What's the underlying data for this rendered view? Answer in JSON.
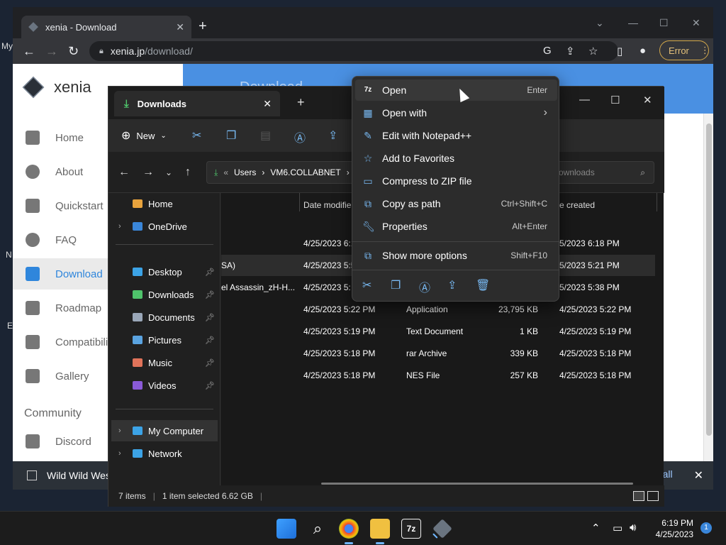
{
  "desktop": {
    "fragments": [
      "My",
      "N",
      "E"
    ]
  },
  "browser": {
    "tab_title": "xenia - Download",
    "url_host": "xenia.jp",
    "url_path": "/download/",
    "error_label": "Error"
  },
  "site": {
    "brand": "xenia",
    "header_title": "Download",
    "nav": [
      {
        "label": "Home"
      },
      {
        "label": "About"
      },
      {
        "label": "Quickstart"
      },
      {
        "label": "FAQ"
      },
      {
        "label": "Download"
      },
      {
        "label": "Roadmap"
      },
      {
        "label": "Compatibilit"
      },
      {
        "label": "Gallery"
      }
    ],
    "community_heading": "Community",
    "community_nav": [
      {
        "label": "Discord"
      }
    ],
    "banner_text": "Wild Wild West",
    "banner_action": "r all"
  },
  "explorer": {
    "tab_title": "Downloads",
    "new_label": "New",
    "breadcrumb": [
      "Users",
      "VM6.COLLABNET"
    ],
    "search_placeholder": "Search Downloads",
    "search_visible": "ownloads",
    "tree": {
      "home": "Home",
      "onedrive": "OneDrive",
      "pinned": [
        "Desktop",
        "Downloads",
        "Documents",
        "Pictures",
        "Music",
        "Videos"
      ],
      "my_computer": "My Computer",
      "network": "Network"
    },
    "columns": {
      "date_modified": "Date modifie",
      "date_created": "e created"
    },
    "rows": [
      {
        "name": "",
        "modified": "4/25/2023 6:1",
        "type": "",
        "size": "",
        "created": "5/2023 6:18 PM"
      },
      {
        "name": "SA)",
        "modified": "4/25/2023 5:5",
        "type": "",
        "size": "",
        "created": "5/2023 5:21 PM"
      },
      {
        "name": "el Assassin_zH-H...",
        "modified": "4/25/2023 5:",
        "type": "",
        "size": "",
        "created": "5/2023 5:38 PM"
      },
      {
        "name": "",
        "modified": "4/25/2023 5:22 PM",
        "type": "Application",
        "size": "23,795 KB",
        "created": "4/25/2023 5:22 PM"
      },
      {
        "name": "",
        "modified": "4/25/2023 5:19 PM",
        "type": "Text Document",
        "size": "1 KB",
        "created": "4/25/2023 5:19 PM"
      },
      {
        "name": "",
        "modified": "4/25/2023 5:18 PM",
        "type": "rar Archive",
        "size": "339 KB",
        "created": "4/25/2023 5:18 PM"
      },
      {
        "name": "",
        "modified": "4/25/2023 5:18 PM",
        "type": "NES File",
        "size": "257 KB",
        "created": "4/25/2023 5:18 PM"
      }
    ],
    "status": {
      "items": "7 items",
      "selected": "1 item selected  6.62 GB"
    }
  },
  "context_menu": {
    "items": [
      {
        "label": "Open",
        "shortcut": "Enter"
      },
      {
        "label": "Open with",
        "shortcut": ""
      },
      {
        "label": "Edit with Notepad++",
        "shortcut": ""
      },
      {
        "label": "Add to Favorites",
        "shortcut": ""
      },
      {
        "label": "Compress to ZIP file",
        "shortcut": ""
      },
      {
        "label": "Copy as path",
        "shortcut": "Ctrl+Shift+C"
      },
      {
        "label": "Properties",
        "shortcut": "Alt+Enter"
      }
    ],
    "more": {
      "label": "Show more options",
      "shortcut": "Shift+F10"
    }
  },
  "taskbar": {
    "time": "6:19 PM",
    "date": "4/25/2023",
    "notifications": "1"
  },
  "colors": {
    "accent": "#2f86dc",
    "explorer_accent": "#78b9f2",
    "error": "#d2a74a"
  }
}
